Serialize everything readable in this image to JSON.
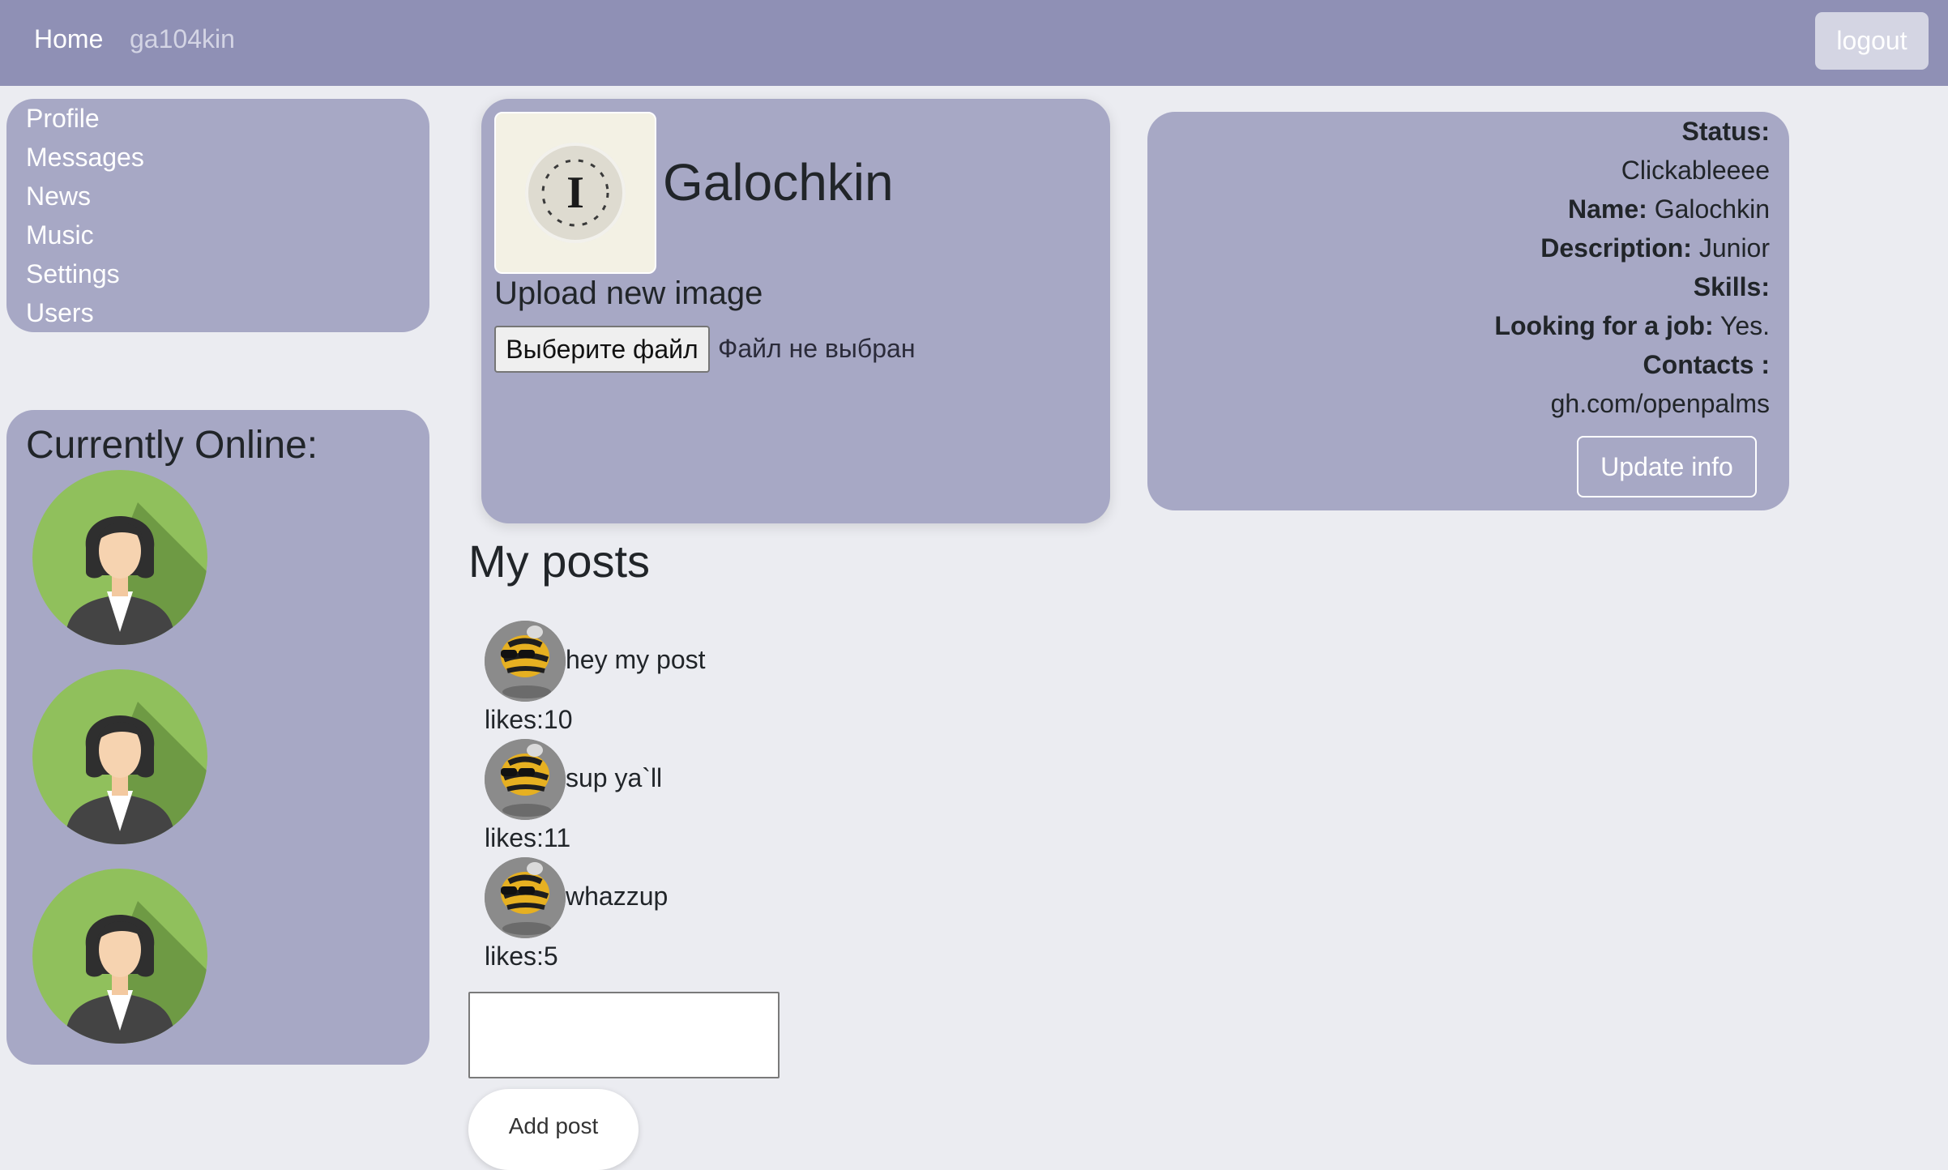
{
  "nav": {
    "home": "Home",
    "username": "ga104kin",
    "logout": "logout"
  },
  "sidebar": {
    "items": [
      {
        "label": "Profile"
      },
      {
        "label": "Messages"
      },
      {
        "label": "News"
      },
      {
        "label": "Music"
      },
      {
        "label": "Settings"
      },
      {
        "label": "Users"
      }
    ]
  },
  "online": {
    "title": "Currently Online:",
    "users": [
      {
        "icon": "female-user-avatar"
      },
      {
        "icon": "female-user-avatar"
      },
      {
        "icon": "female-user-avatar"
      }
    ]
  },
  "profile": {
    "full_name": "Galochkin",
    "photo_icon": "round-logo-image",
    "photo_text": "I",
    "upload_title": "Upload new image",
    "file_button": "Выберите файл",
    "file_status": "Файл не выбран"
  },
  "info": {
    "status_label": "Status:",
    "status_value": "Clickableeee",
    "name_label": "Name:",
    "name_value": "Galochkin",
    "description_label": "Description:",
    "description_value": "Junior",
    "skills_label": "Skills:",
    "job_label": "Looking for a job:",
    "job_value": "Yes.",
    "contacts_label": "Contacts :",
    "contacts_value": "gh.com/openpalms",
    "update_button": "Update info"
  },
  "posts": {
    "title": "My posts",
    "items": [
      {
        "text": "hey my post",
        "likes": "likes:10",
        "icon": "bee-avatar"
      },
      {
        "text": "sup ya`ll",
        "likes": "likes:11",
        "icon": "bee-avatar"
      },
      {
        "text": "whazzup",
        "likes": "likes:5",
        "icon": "bee-avatar"
      }
    ],
    "input_value": "",
    "add_button": "Add post"
  },
  "colors": {
    "topbar": "#8f90b5",
    "panel": "#a7a8c5",
    "background": "#ebecf1",
    "avatar_green": "#8cbe5a"
  }
}
